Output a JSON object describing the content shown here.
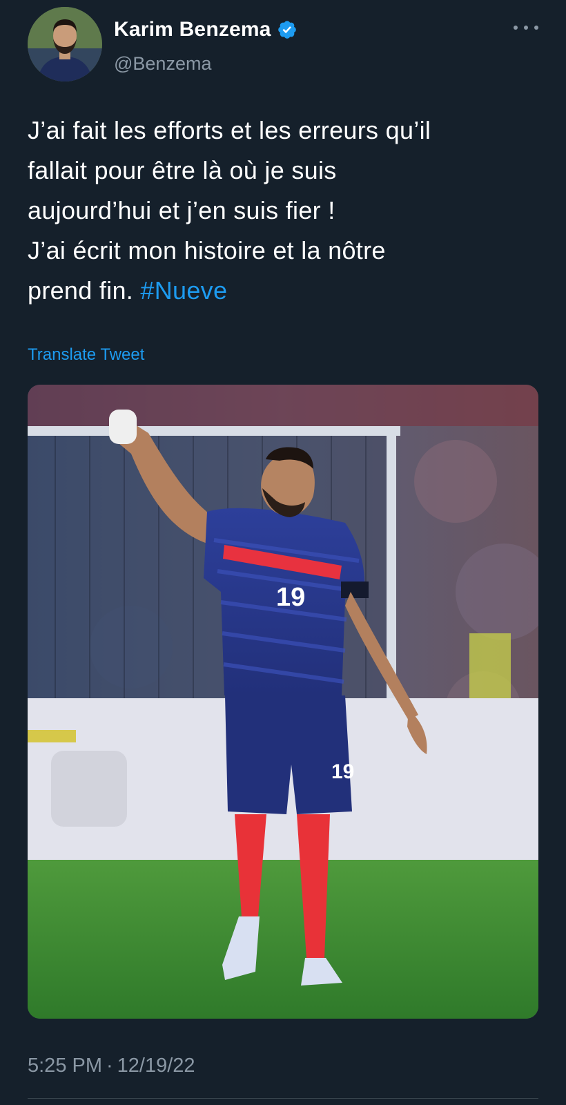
{
  "author": {
    "display_name": "Karim Benzema",
    "handle": "@Benzema",
    "verified_icon": "verified-badge-icon",
    "colors": {
      "verified": "#1d9bf0"
    }
  },
  "tweet": {
    "lines": [
      "J’ai fait les efforts et les erreurs qu’il",
      "fallait pour être là où je suis",
      "aujourd’hui et j’en suis fier !",
      "J’ai écrit mon histoire et la nôtre"
    ],
    "last_line_text": "prend fin. ",
    "hashtag": "#Nueve",
    "translate_label": "Translate Tweet"
  },
  "media": {
    "jersey_number": "19",
    "shorts_number": "19"
  },
  "meta": {
    "time": "5:25 PM",
    "separator": "·",
    "date": "12/19/22"
  },
  "theme": {
    "background": "#15202b",
    "text": "#ffffff",
    "secondary_text": "#8b98a5",
    "link": "#1d9bf0"
  }
}
